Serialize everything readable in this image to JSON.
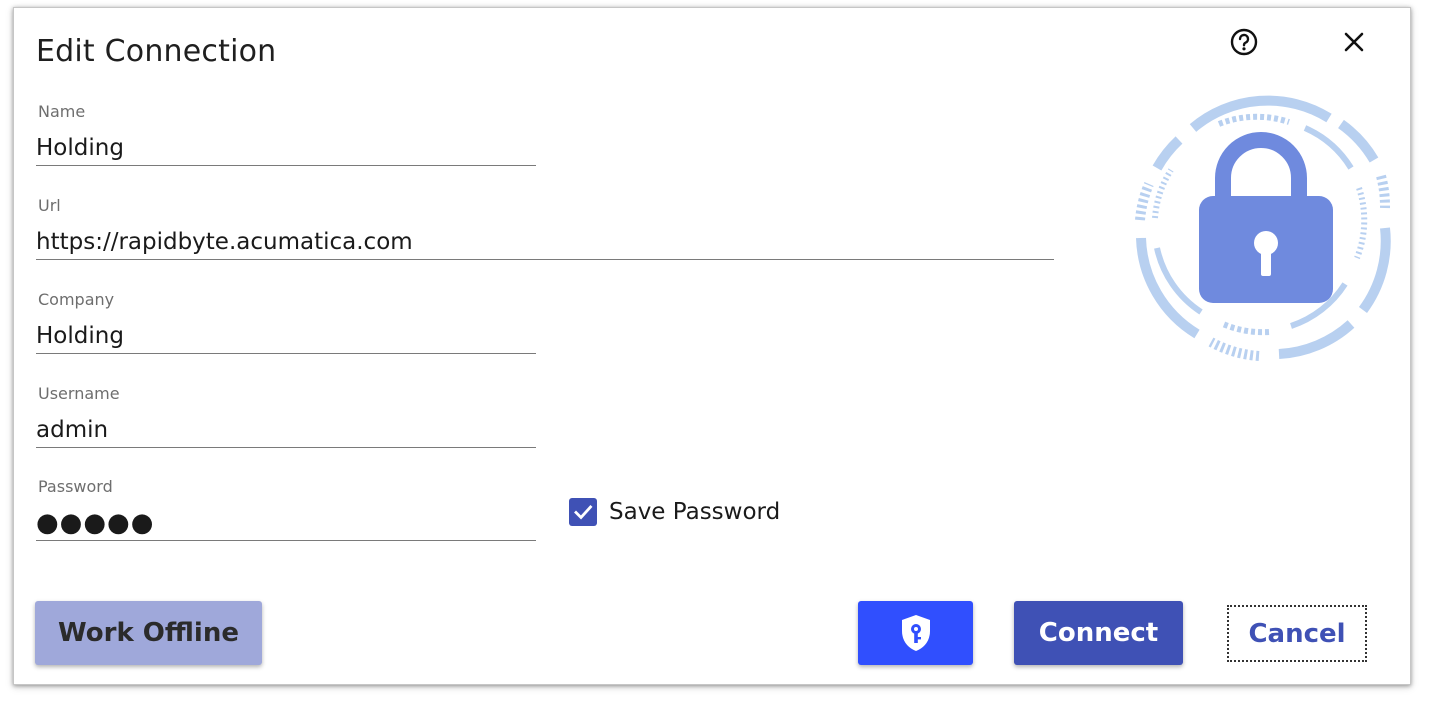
{
  "dialog": {
    "title": "Edit Connection"
  },
  "header_icons": {
    "help": "help-circle-icon",
    "close": "close-icon"
  },
  "fields": {
    "name": {
      "label": "Name",
      "value": "Holding"
    },
    "url": {
      "label": "Url",
      "value": "https://rapidbyte.acumatica.com"
    },
    "company": {
      "label": "Company",
      "value": "Holding"
    },
    "username": {
      "label": "Username",
      "value": "admin"
    },
    "password": {
      "label": "Password",
      "value": "●●●●●"
    }
  },
  "save_password": {
    "label": "Save Password",
    "checked": true
  },
  "illustration": {
    "icon": "padlock-icon"
  },
  "buttons": {
    "work_offline": "Work Offline",
    "vault_icon": "shield-key-icon",
    "connect": "Connect",
    "cancel": "Cancel"
  },
  "colors": {
    "primary": "#3f51b5",
    "primary_light": "#9fa8da",
    "vault_button": "#304ffe",
    "lock_body": "#6f8ade",
    "lock_ring": "#b8d0f0"
  }
}
